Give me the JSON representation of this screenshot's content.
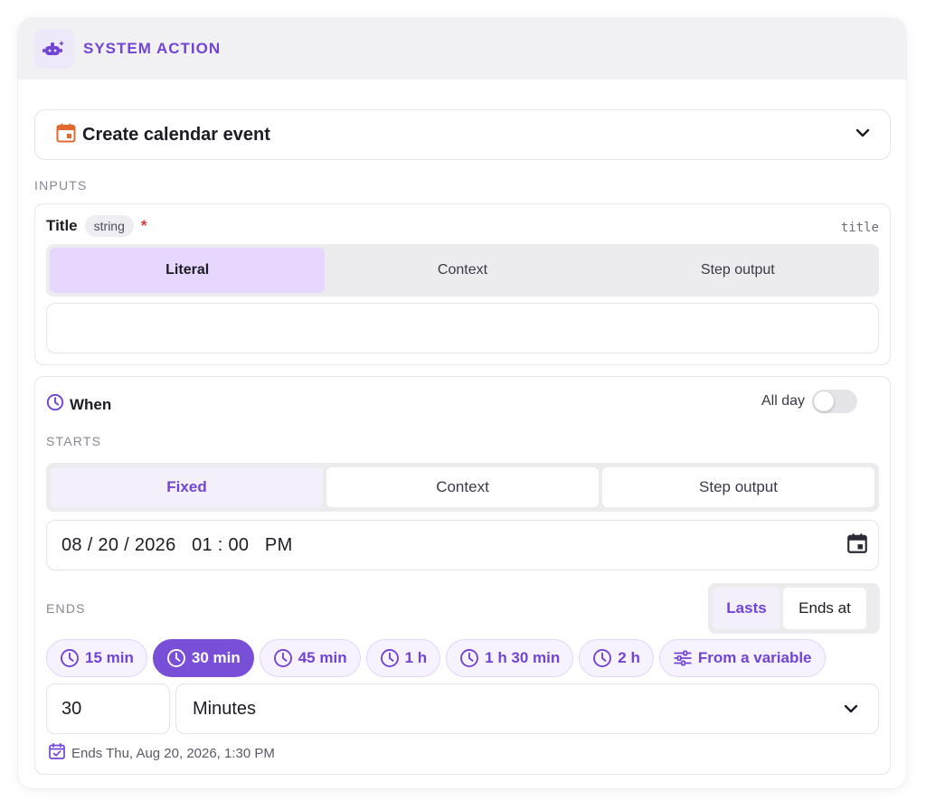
{
  "header": {
    "title": "SYSTEM ACTION",
    "icon": "robot-sparkle-icon",
    "accent": "#7144d6"
  },
  "action": {
    "label": "Create calendar event",
    "icon": "calendar-icon",
    "icon_color": "#e0692f"
  },
  "inputs_label": "INPUTS",
  "title_field": {
    "name": "Title",
    "type": "string",
    "required_mark": "*",
    "key": "title",
    "modes": [
      "Literal",
      "Context",
      "Step output"
    ],
    "active_mode": "Literal",
    "value": ""
  },
  "when": {
    "title": "When",
    "all_day_label": "All day",
    "all_day": false,
    "starts_label": "STARTS",
    "start_modes": [
      "Fixed",
      "Context",
      "Step output"
    ],
    "active_start_mode": "Fixed",
    "start_value": "08 / 20 / 2026   01 : 00   PM",
    "ends_label": "ENDS",
    "ends_modes": [
      "Lasts",
      "Ends at"
    ],
    "active_ends_mode": "Lasts",
    "durations": [
      "15 min",
      "30 min",
      "45 min",
      "1 h",
      "1 h 30 min",
      "2 h",
      "From a variable"
    ],
    "active_duration": "30 min",
    "duration_amount": "30",
    "duration_unit": "Minutes",
    "ends_summary": "Ends Thu, Aug 20, 2026, 1:30 PM"
  }
}
